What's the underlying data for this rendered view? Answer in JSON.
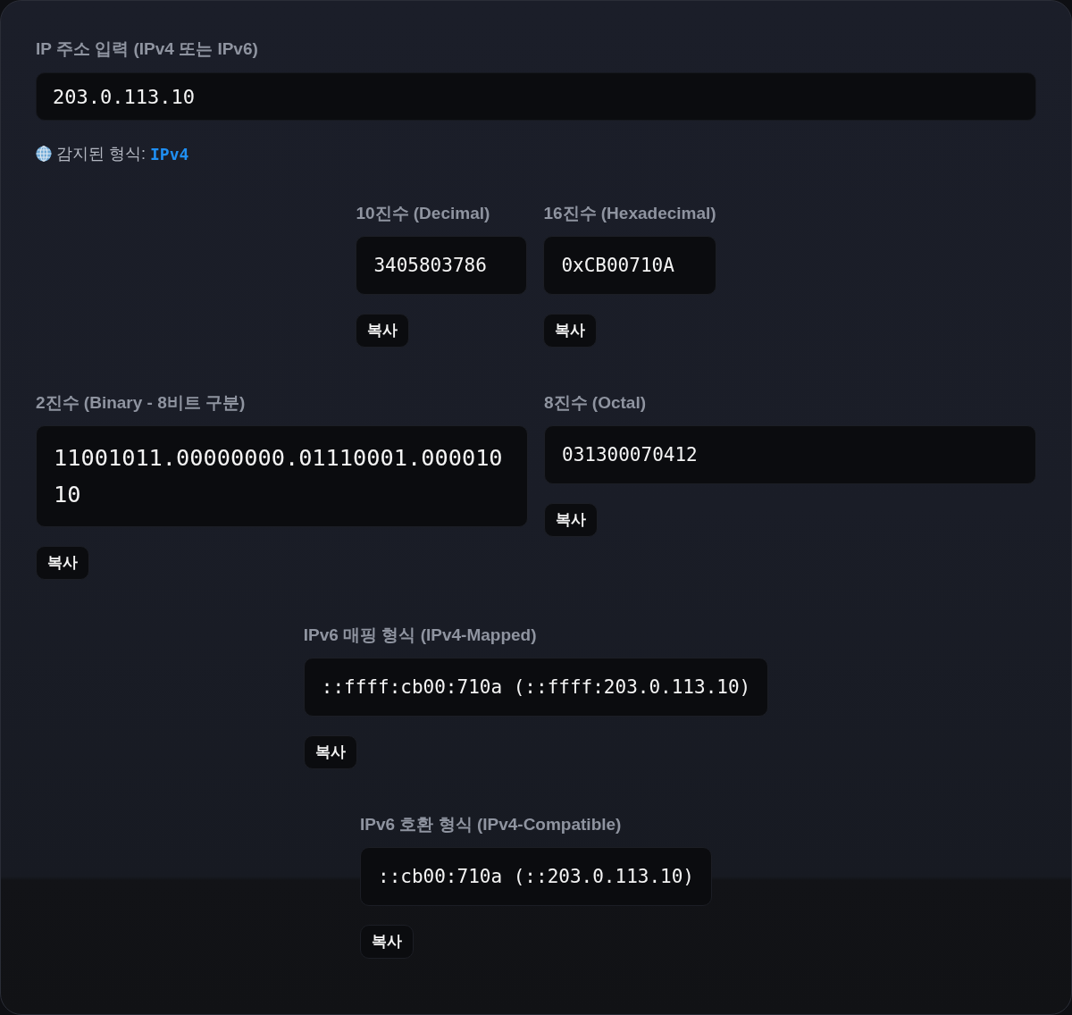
{
  "input": {
    "label": "IP 주소 입력 (IPv4 또는 IPv6)",
    "value": "203.0.113.10"
  },
  "detected": {
    "label": "감지된 형식:",
    "value": "IPv4"
  },
  "results": [
    {
      "items": [
        {
          "kind": "compact",
          "label": "10진수 (Decimal)",
          "value": "3405803786",
          "copy": "복사"
        },
        {
          "kind": "compact",
          "label": "16진수 (Hexadecimal)",
          "value": "0xCB00710A",
          "copy": "복사"
        }
      ]
    },
    {
      "items": [
        {
          "kind": "big",
          "label": "2진수 (Binary - 8비트 구분)",
          "value": "11001011.00000000.01110001.00001010",
          "copy": "복사"
        },
        {
          "kind": "half",
          "label": "8진수 (Octal)",
          "value": "031300070412",
          "copy": "복사"
        }
      ]
    },
    {
      "items": [
        {
          "kind": "compact",
          "label": "IPv6 매핑 형식 (IPv4-Mapped)",
          "value": "::ffff:cb00:710a (::ffff:203.0.113.10)",
          "copy": "복사"
        }
      ]
    },
    {
      "items": [
        {
          "kind": "compact",
          "label": "IPv6 호환 형식 (IPv4-Compatible)",
          "value": "::cb00:710a (::203.0.113.10)",
          "copy": "복사"
        }
      ]
    }
  ]
}
